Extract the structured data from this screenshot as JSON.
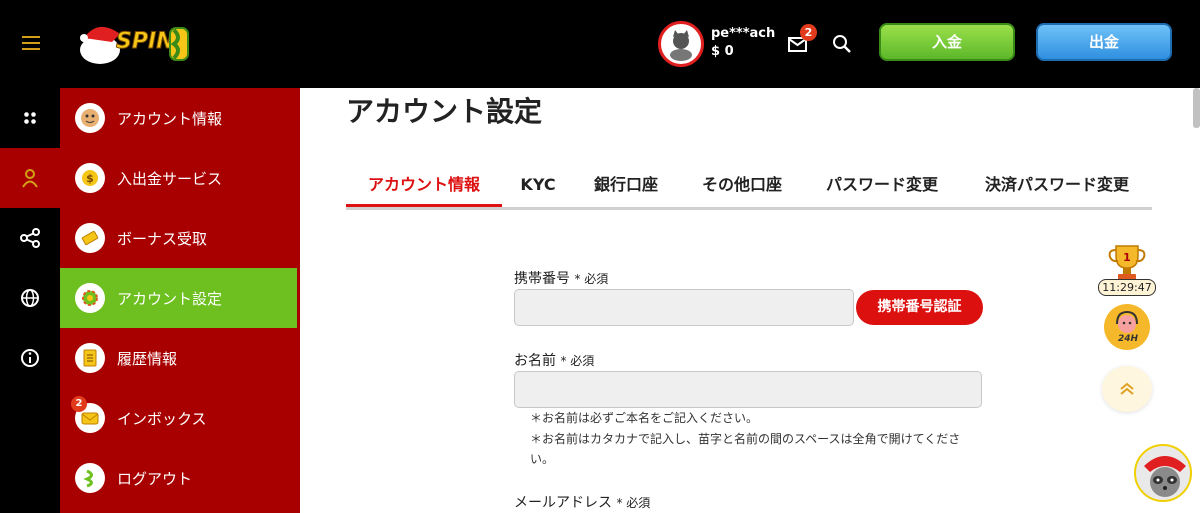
{
  "header": {
    "logo_text": "SPIN",
    "user": {
      "name": "pe***ach",
      "balance": "$ 0"
    },
    "mail_badge": "2",
    "deposit_label": "入金",
    "withdraw_label": "出金"
  },
  "rail": {
    "items": [
      "grid-icon",
      "user-icon",
      "share-icon",
      "globe-icon",
      "info-icon"
    ]
  },
  "sidebar": {
    "items": [
      {
        "label": "アカウント情報"
      },
      {
        "label": "入出金サービス"
      },
      {
        "label": "ボーナス受取"
      },
      {
        "label": "アカウント設定"
      },
      {
        "label": "履歴情報"
      },
      {
        "label": "インボックス",
        "badge": "2"
      },
      {
        "label": "ログアウト"
      }
    ]
  },
  "main": {
    "title": "アカウント設定",
    "tabs": [
      {
        "label": "アカウント情報"
      },
      {
        "label": "KYC"
      },
      {
        "label": "銀行口座"
      },
      {
        "label": "その他口座"
      },
      {
        "label": "パスワード変更"
      },
      {
        "label": "決済パスワード変更"
      }
    ],
    "phone": {
      "label": "携帯番号",
      "required": "* 必須",
      "value": "",
      "verify_label": "携帯番号認証"
    },
    "name": {
      "label": "お名前",
      "required": "* 必須",
      "value": "",
      "note1": "＊お名前は必ずご本名をご記入ください。",
      "note2": "＊お名前はカタカナで記入し、苗字と名前の間のスペースは全角で開けてください。"
    },
    "email": {
      "label": "メールアドレス",
      "required": "* 必須"
    }
  },
  "widgets": {
    "timer": "11:29:47",
    "support_text": "24H"
  },
  "colors": {
    "header_bg": "#000000",
    "sidebar_bg": "#a80000",
    "active_item": "#6dc01f",
    "accent_red": "#dd1010"
  }
}
